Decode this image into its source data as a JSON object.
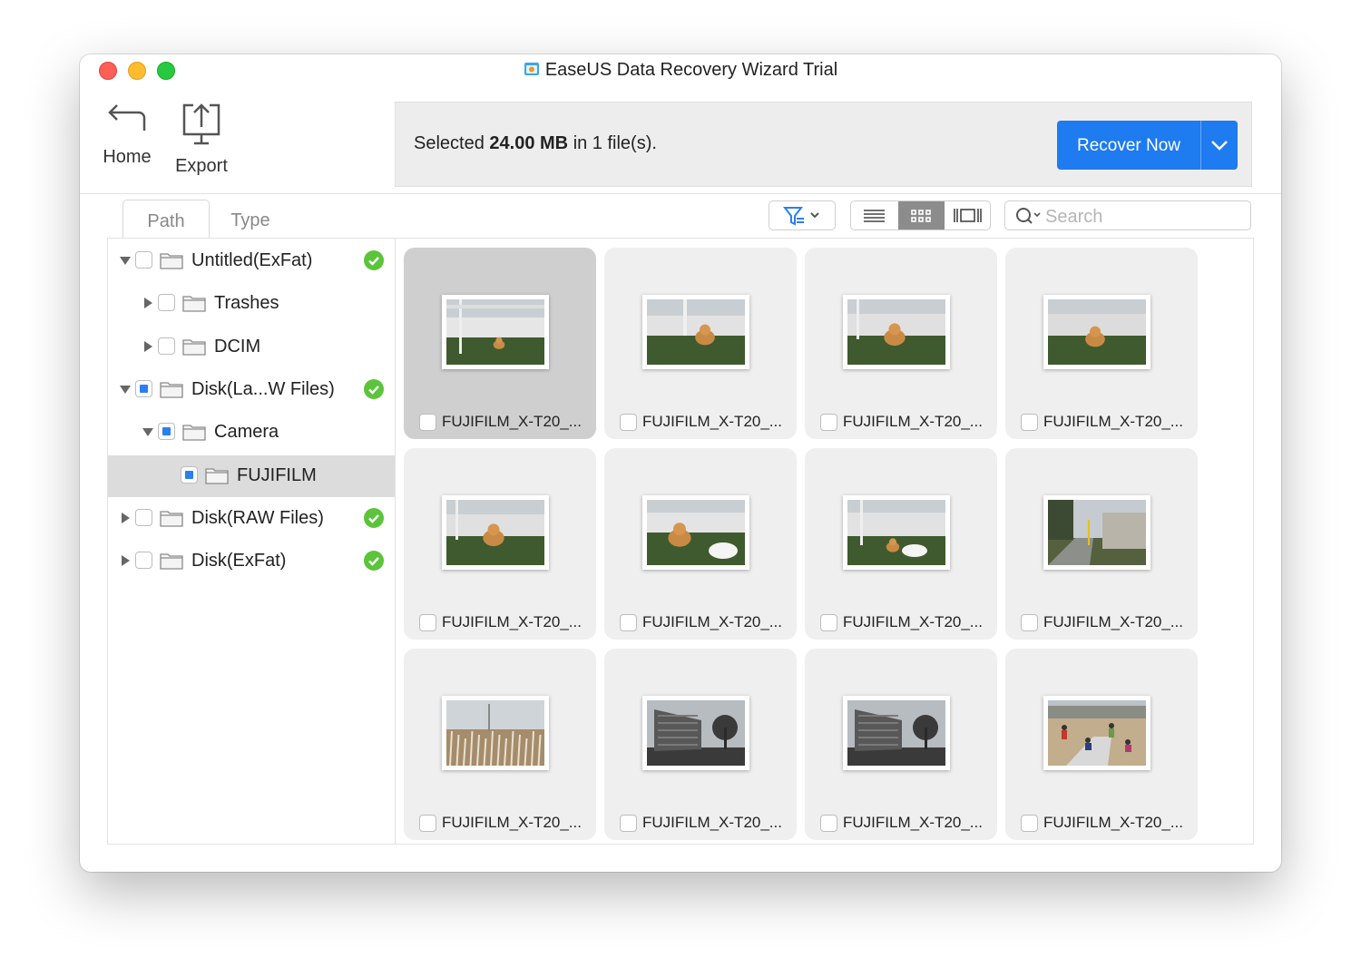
{
  "window": {
    "title": "EaseUS Data Recovery Wizard Trial"
  },
  "toolbar": {
    "home_label": "Home",
    "export_label": "Export"
  },
  "status": {
    "prefix": "Selected",
    "size": "24.00 MB",
    "suffix": "in 1 file(s)."
  },
  "recover": {
    "label": "Recover Now"
  },
  "colors": {
    "accent": "#1e7bf0",
    "ok": "#5cc43a",
    "partial": "#2b7ff0"
  },
  "tabs": {
    "path": "Path",
    "type": "Type"
  },
  "search": {
    "placeholder": "Search",
    "value": ""
  },
  "tree": [
    {
      "label": "Untitled(ExFat)",
      "expanded": true,
      "check": "none",
      "ok": true,
      "icon": "folder-icon"
    },
    {
      "label": "Trashes",
      "expanded": false,
      "check": "none",
      "ok": false,
      "icon": "folder-icon"
    },
    {
      "label": "DCIM",
      "expanded": false,
      "check": "none",
      "ok": false,
      "icon": "folder-icon"
    },
    {
      "label": "Disk(La...W Files)",
      "expanded": true,
      "check": "partial",
      "ok": true,
      "icon": "folder-icon"
    },
    {
      "label": "Camera",
      "expanded": true,
      "check": "partial",
      "ok": false,
      "icon": "folder-icon"
    },
    {
      "label": "FUJIFILM",
      "expanded": null,
      "check": "partial",
      "ok": false,
      "selected": true,
      "icon": "folder-icon"
    },
    {
      "label": "Disk(RAW Files)",
      "expanded": false,
      "check": "none",
      "ok": true,
      "icon": "folder-icon"
    },
    {
      "label": "Disk(ExFat)",
      "expanded": false,
      "check": "none",
      "ok": true,
      "icon": "folder-icon"
    }
  ],
  "files": [
    {
      "name": "FUJIFILM_X-T20_...",
      "selected": true,
      "scene": "cat-far"
    },
    {
      "name": "FUJIFILM_X-T20_...",
      "selected": false,
      "scene": "cat-walk"
    },
    {
      "name": "FUJIFILM_X-T20_...",
      "selected": false,
      "scene": "cat-front"
    },
    {
      "name": "FUJIFILM_X-T20_...",
      "selected": false,
      "scene": "cat-sniff"
    },
    {
      "name": "FUJIFILM_X-T20_...",
      "selected": false,
      "scene": "cat-front"
    },
    {
      "name": "FUJIFILM_X-T20_...",
      "selected": false,
      "scene": "cat-bowl"
    },
    {
      "name": "FUJIFILM_X-T20_...",
      "selected": false,
      "scene": "cat-bowl-far"
    },
    {
      "name": "FUJIFILM_X-T20_...",
      "selected": false,
      "scene": "path"
    },
    {
      "name": "FUJIFILM_X-T20_...",
      "selected": false,
      "scene": "field"
    },
    {
      "name": "FUJIFILM_X-T20_...",
      "selected": false,
      "scene": "building"
    },
    {
      "name": "FUJIFILM_X-T20_...",
      "selected": false,
      "scene": "building"
    },
    {
      "name": "FUJIFILM_X-T20_...",
      "selected": false,
      "scene": "kids"
    }
  ]
}
